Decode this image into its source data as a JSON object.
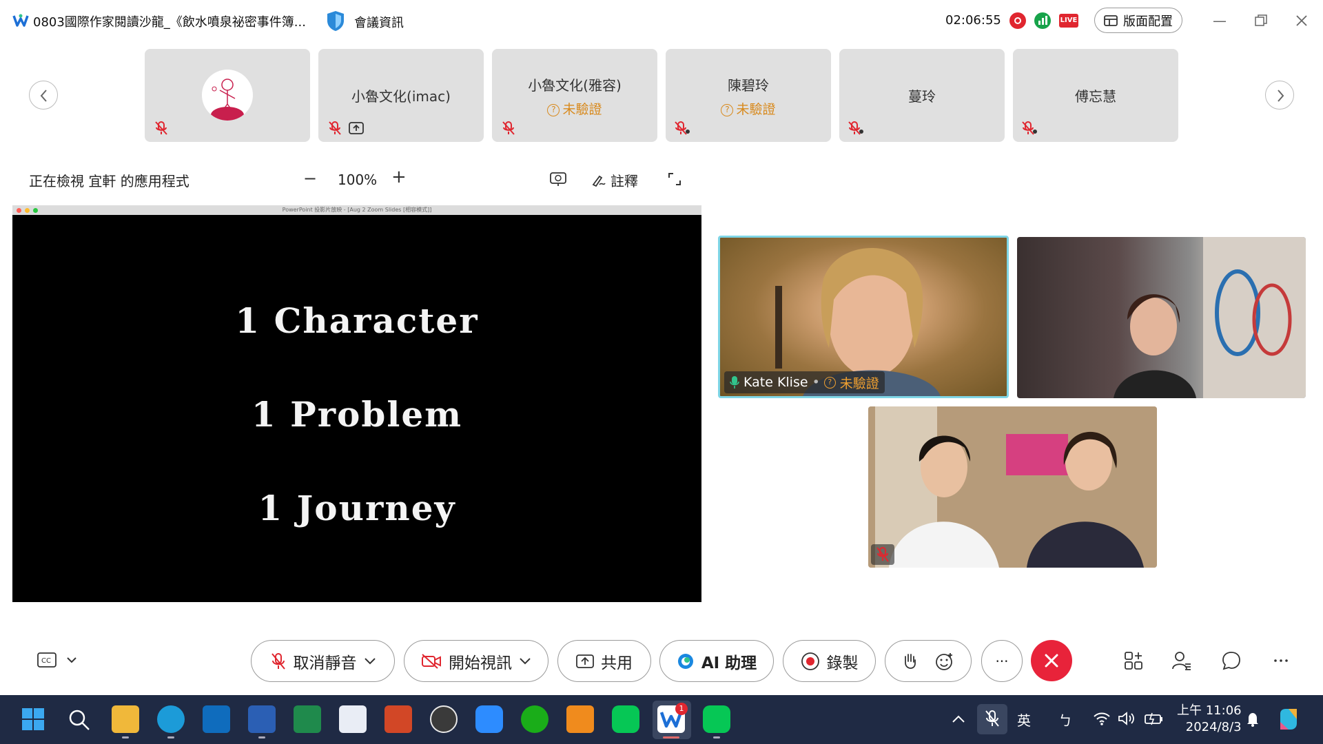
{
  "titlebar": {
    "meeting_title": "0803國際作家閱讀沙龍_《飲水噴泉祕密事件簿...",
    "meeting_info": "會議資訊",
    "timer": "02:06:55",
    "live_badge": "LIVE",
    "layout_button": "版面配置"
  },
  "participants": [
    {
      "name": "",
      "has_avatar": true,
      "muted": true
    },
    {
      "name": "小魯文化(imac)",
      "muted": true,
      "sharing": true
    },
    {
      "name": "小魯文化(雅容)",
      "unverified": "未驗證",
      "muted": true
    },
    {
      "name": "陳碧玲",
      "unverified": "未驗證",
      "muted": true
    },
    {
      "name": "蔓玲",
      "muted": true
    },
    {
      "name": "傅忘慧",
      "muted": true
    }
  ],
  "share_toolbar": {
    "viewing_label": "正在檢視 宜軒 的應用程式",
    "zoom_out": "−",
    "zoom_level": "100%",
    "zoom_in": "+",
    "annotate_label": "註釋"
  },
  "shared_screen": {
    "window_title": "PowerPoint 投影片放映 - [Aug 2 Zoom Slides [相容模式]]",
    "slide_lines": [
      "1 Character",
      "1 Problem",
      "1 Journey"
    ]
  },
  "videos": {
    "speaker_name": "Kate Klise",
    "speaker_status": "未驗證"
  },
  "toolbar": {
    "unmute": "取消靜音",
    "start_video": "開始視訊",
    "share": "共用",
    "ai_assistant": "AI 助理",
    "record": "錄製",
    "more": "···"
  },
  "taskbar": {
    "ime_lang": "英",
    "ime_mode": "ㄅ",
    "time": "上午 11:06",
    "date": "2024/8/3",
    "webex_badge": "1"
  },
  "colors": {
    "end_call": "#e8233a",
    "unverified": "#d88a1e",
    "active_speaker_border": "#7fd6e6",
    "taskbar": "#1f2a44"
  }
}
